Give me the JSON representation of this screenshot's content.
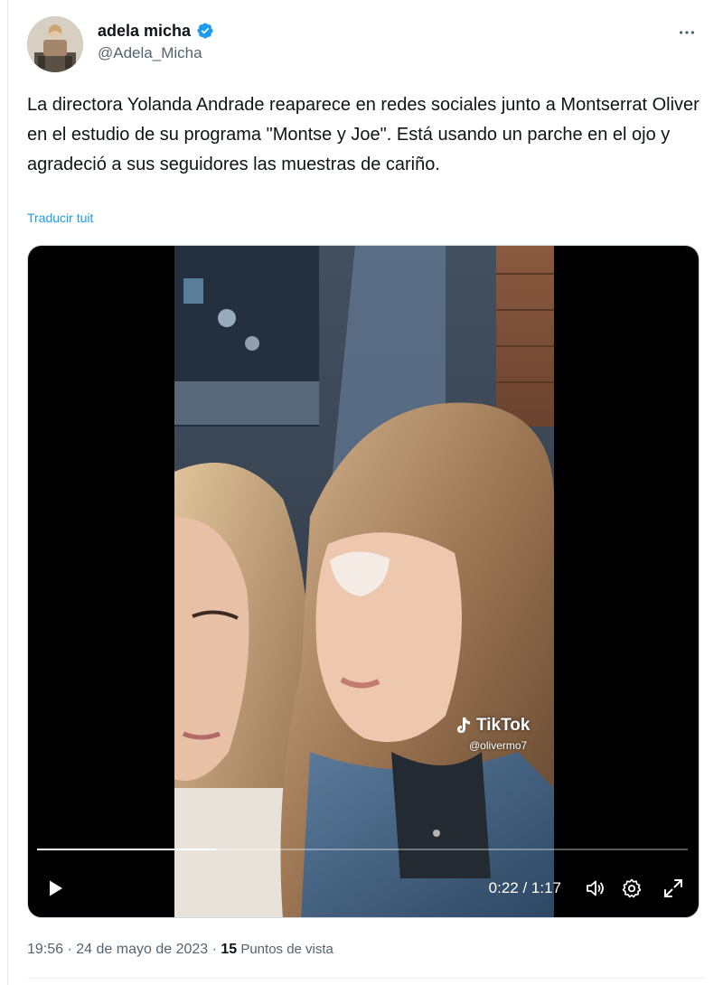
{
  "author": {
    "display_name": "adela micha",
    "handle": "@Adela_Micha",
    "verified": true
  },
  "tweet": {
    "text": "La directora Yolanda Andrade reaparece en redes sociales junto a Montserrat Oliver en el estudio de su programa \"Montse y Joe\". Está usando un parche en el ojo y agradeció a sus seguidores las muestras de cariño.",
    "translate_label": "Traducir tuit"
  },
  "video": {
    "watermark_brand": "TikTok",
    "watermark_user": "@olivermo7",
    "current_time": "0:22",
    "separator": " / ",
    "duration": "1:17",
    "progress_fraction": 0.275
  },
  "meta": {
    "time": "19:56",
    "dot1": " · ",
    "date": "24 de mayo de 2023",
    "dot2": " · ",
    "views_count": "15",
    "views_label": " Puntos de vista"
  },
  "icons": {
    "verified": "verified-badge-icon",
    "more": "more-horizontal-icon",
    "play": "play-icon",
    "volume": "volume-icon",
    "settings": "gear-icon",
    "fullscreen": "expand-icon"
  },
  "colors": {
    "accent": "#1d9bf0",
    "text_primary": "#0f1419",
    "text_secondary": "#536471"
  }
}
